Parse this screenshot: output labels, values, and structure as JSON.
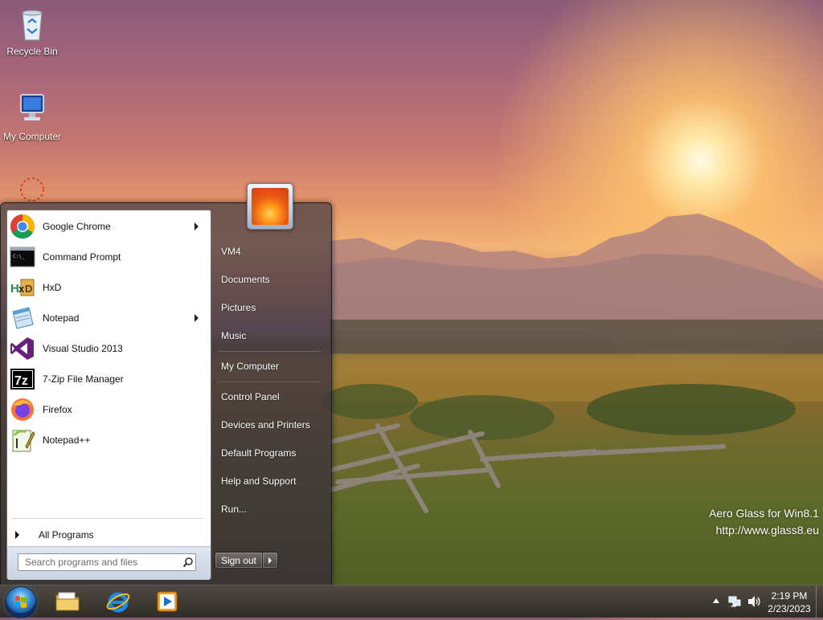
{
  "desktop": {
    "icons": [
      {
        "label": "Recycle Bin"
      },
      {
        "label": "My Computer"
      }
    ],
    "watermark": [
      "Aero Glass for Win8.1",
      "http://www.glass8.eu"
    ]
  },
  "start_menu": {
    "programs": [
      {
        "label": "Google Chrome",
        "icon": "chrome-icon",
        "submenu": true
      },
      {
        "label": "Command Prompt",
        "icon": "command-prompt-icon",
        "submenu": false
      },
      {
        "label": "HxD",
        "icon": "hxd-icon",
        "submenu": false
      },
      {
        "label": "Notepad",
        "icon": "notepad-icon",
        "submenu": true
      },
      {
        "label": "Visual Studio 2013",
        "icon": "visual-studio-icon",
        "submenu": false
      },
      {
        "label": "7-Zip File Manager",
        "icon": "7zip-icon",
        "submenu": false
      },
      {
        "label": "Firefox",
        "icon": "firefox-icon",
        "submenu": false
      },
      {
        "label": "Notepad++",
        "icon": "notepadpp-icon",
        "submenu": false
      }
    ],
    "all_programs": "All Programs",
    "search_placeholder": "Search programs and files",
    "right_items": [
      {
        "label": "VM4"
      },
      {
        "label": "Documents"
      },
      {
        "label": "Pictures"
      },
      {
        "label": "Music"
      },
      {
        "label": "My Computer"
      },
      {
        "label": "Control Panel"
      },
      {
        "label": "Devices and Printers"
      },
      {
        "label": "Default Programs"
      },
      {
        "label": "Help and Support"
      },
      {
        "label": "Run..."
      }
    ],
    "sign_out": "Sign out"
  },
  "taskbar": {
    "pinned": [
      {
        "icon": "file-explorer-icon"
      },
      {
        "icon": "internet-explorer-icon"
      },
      {
        "icon": "media-player-icon"
      }
    ],
    "clock": {
      "time": "2:19 PM",
      "date": "2/23/2023"
    }
  }
}
